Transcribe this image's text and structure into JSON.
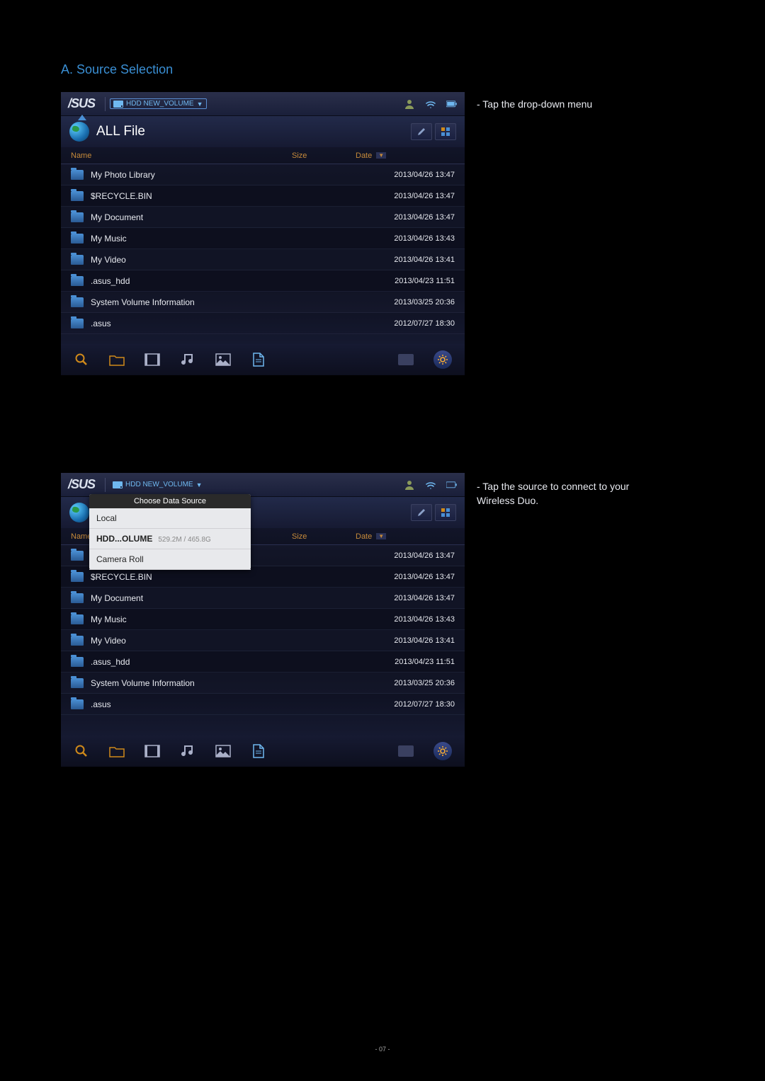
{
  "section_title": "A. Source Selection",
  "annotations": {
    "a1": "- Tap the drop-down menu",
    "a2": "- Tap the source to connect to your Wireless Duo."
  },
  "page_number": "- 07 -",
  "screenshot": {
    "logo": "/SUS",
    "drive_label": "HDD NEW_VOLUME",
    "title": "ALL File",
    "cols": {
      "name": "Name",
      "size": "Size",
      "date": "Date"
    },
    "files": [
      {
        "name": "My Photo Library",
        "date": "2013/04/26 13:47"
      },
      {
        "name": "$RECYCLE.BIN",
        "date": "2013/04/26 13:47"
      },
      {
        "name": "My Document",
        "date": "2013/04/26 13:47"
      },
      {
        "name": "My Music",
        "date": "2013/04/26 13:43"
      },
      {
        "name": "My Video",
        "date": "2013/04/26 13:41"
      },
      {
        "name": ".asus_hdd",
        "date": "2013/04/23 11:51"
      },
      {
        "name": "System Volume Information",
        "date": "2013/03/25 20:36"
      },
      {
        "name": ".asus",
        "date": "2012/07/27 18:30"
      }
    ]
  },
  "dropdown": {
    "header": "Choose Data Source",
    "items": [
      {
        "label": "Local",
        "sub": ""
      },
      {
        "label": "HDD...OLUME",
        "sub": "529.2M / 465.8G"
      },
      {
        "label": "Camera Roll",
        "sub": ""
      }
    ]
  }
}
